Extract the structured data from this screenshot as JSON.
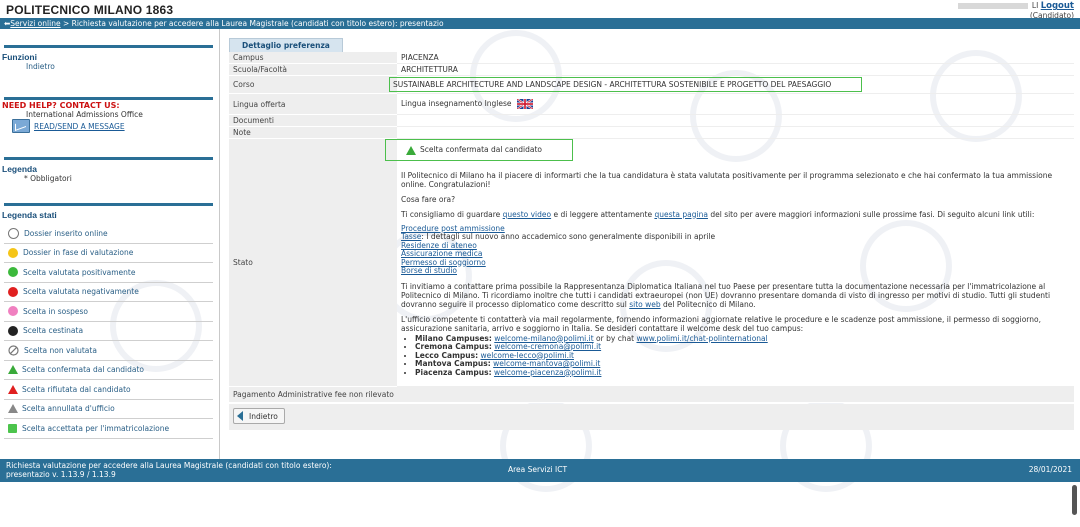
{
  "header": {
    "brand": "POLITECNICO MILANO 1863",
    "user_id": "LI",
    "logout_label": "Logout",
    "role": "(Candidato)"
  },
  "breadcrumb": {
    "back_arrow": "⬅",
    "home_link": "Servizi online",
    "separator": " > ",
    "current": "Richiesta valutazione per accedere alla Laurea Magistrale (candidati con titolo estero): presentazio"
  },
  "sidebar": {
    "funzioni_title": "Funzioni",
    "funzioni_item": "Indietro",
    "help_title": "NEED HELP? CONTACT US:",
    "help_office": "International Admissions Office",
    "help_link": "READ/SEND A MESSAGE",
    "legenda_title": "Legenda",
    "legenda_item": "* Obbligatori",
    "stati_title": "Legenda stati",
    "stati": [
      {
        "label": "Dossier inserito online",
        "icon": "circle-empty-icon",
        "color": "#ffffff"
      },
      {
        "label": "Dossier in fase di valutazione",
        "icon": "circle-yellow-icon",
        "color": "#f5c518"
      },
      {
        "label": "Scelta valutata positivamente",
        "icon": "circle-green-icon",
        "color": "#3cb93c"
      },
      {
        "label": "Scelta valutata negativamente",
        "icon": "circle-red-icon",
        "color": "#e02020"
      },
      {
        "label": "Scelta in sospeso",
        "icon": "circle-pink-icon",
        "color": "#f080c0"
      },
      {
        "label": "Scelta cestinata",
        "icon": "circle-black-icon",
        "color": "#222222"
      },
      {
        "label": "Scelta non valutata",
        "icon": "circle-slash-icon",
        "color": "#888888"
      },
      {
        "label": "Scelta confermata dal candidato",
        "icon": "triangle-green-icon",
        "color": "#3aaa3a"
      },
      {
        "label": "Scelta rifiutata dal candidato",
        "icon": "triangle-red-icon",
        "color": "#e02020"
      },
      {
        "label": "Scelta annullata d'ufficio",
        "icon": "triangle-gray-icon",
        "color": "#888888"
      },
      {
        "label": "Scelta accettata per l'immatricolazione",
        "icon": "square-green-icon",
        "color": "#4cc44c"
      }
    ]
  },
  "detail": {
    "tab_label": "Dettaglio preferenza",
    "rows": {
      "campus_label": "Campus",
      "campus_value": "PIACENZA",
      "scuola_label": "Scuola/Facoltà",
      "scuola_value": "ARCHITETTURA",
      "corso_label": "Corso",
      "corso_value": "SUSTAINABLE ARCHITECTURE AND LANDSCAPE DESIGN - ARCHITETTURA SOSTENIBILE E PROGETTO DEL PAESAGGIO",
      "lingua_label": "Lingua offerta",
      "lingua_value": "Lingua insegnamento Inglese",
      "documenti_label": "Documenti",
      "note_label": "Note",
      "stato_label": "Stato",
      "pagamento_label": "Pagamento Administrative fee non rilevato"
    },
    "stato": {
      "status_text": "Scelta confermata dal candidato",
      "para1": "Il Politecnico di Milano ha il piacere di informarti che la tua candidatura è stata valutata positivamente per il programma selezionato e che hai confermato la tua ammissione online. Congratulazioni!",
      "para2": "Cosa fare ora?",
      "para3_pre": "Ti consigliamo di guardare ",
      "para3_link1": "questo video",
      "para3_mid": " e di leggere attentamente ",
      "para3_link2": "questa pagina",
      "para3_post": " del sito per avere maggiori informazioni sulle prossime fasi. Di seguito alcuni link utili:",
      "link_procedure": "Procedure post ammissione",
      "link_tasse": "Tasse",
      "tasse_note": ": I dettagli sul nuovo anno accademico sono generalmente disponibili in aprile",
      "link_residenze": "Residenze di ateneo",
      "link_assicurazione": "Assicurazione medica",
      "link_permesso": "Permesso di soggiorno",
      "link_borse": "Borse di studio",
      "para4_pre": "Ti invitiamo a contattare prima possibile la Rappresentanza Diplomatica Italiana nel tuo Paese per presentare tutta la documentazione necessaria per l'immatricolazione al Politecnico di Milano. Ti ricordiamo inoltre che tutti i candidati extraeuropei (non UE) dovranno presentare domanda di visto di ingresso per motivi di studio. Tutti gli studenti dovranno seguire il processo diplomatico come descritto sul ",
      "para4_link": "sito web",
      "para4_post": " del Politecnico di Milano.",
      "para5": "L'ufficio competente ti contatterà via mail regolarmente, fornendo informazioni aggiornate relative le procedure e le scadenze post ammissione, il permesso di soggiorno, assicurazione sanitaria, arrivo e soggiorno in Italia. Se desideri contattare il welcome desk del tuo campus:",
      "campuses": [
        {
          "name": "Milano Campuses:",
          "email": "welcome-milano@polimi.it",
          "extra_pre": " or by chat ",
          "extra_link": "www.polimi.it/chat-polinternational"
        },
        {
          "name": "Cremona Campus:",
          "email": "welcome-cremona@polimi.it"
        },
        {
          "name": "Lecco Campus:",
          "email": "welcome-lecco@polimi.it"
        },
        {
          "name": "Mantova Campus:",
          "email": "welcome-mantova@polimi.it"
        },
        {
          "name": "Piacenza Campus:",
          "email": "welcome-piacenza@polimi.it"
        }
      ]
    },
    "back_button": "Indietro"
  },
  "footer": {
    "left": "Richiesta valutazione per accedere alla Laurea Magistrale (candidati con titolo estero): presentazio v. 1.13.9 / 1.13.9",
    "center": "Area Servizi ICT",
    "right": "28/01/2021"
  },
  "colors": {
    "accent": "#2a6f96",
    "highlight": "#4cbf4c",
    "help_red": "#cc1111"
  }
}
